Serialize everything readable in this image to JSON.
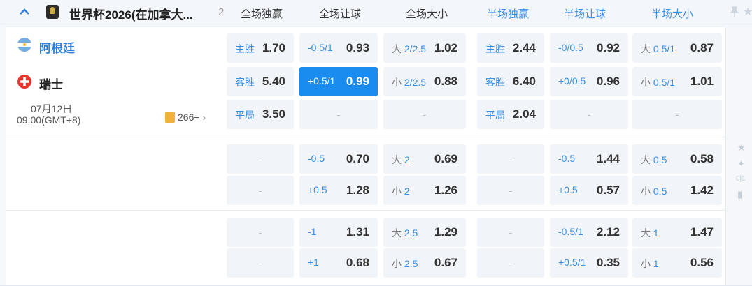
{
  "header": {
    "league": "世界杯2026(在加拿大...",
    "count": "2",
    "columns": [
      "全场独赢",
      "全场让球",
      "全场大小",
      "半场独赢",
      "半场让球",
      "半场大小"
    ]
  },
  "match": {
    "home": "阿根廷",
    "away": "瑞士",
    "date": "07月12日",
    "time": "09:00(GMT+8)",
    "more_bets": "266+"
  },
  "rows": [
    [
      "主胜|1.70",
      "-0.5/1|0.93",
      "大 2/2.5|1.02",
      "主胜|2.44",
      "-0/0.5|0.92",
      "大 0.5/1|0.87"
    ],
    [
      "客胜|5.40",
      "+0.5/1|0.99",
      "小 2/2.5|0.88",
      "客胜|6.40",
      "+0/0.5|0.96",
      "小 0.5/1|1.01"
    ],
    [
      "平局|3.50",
      "-",
      "-",
      "平局|2.04",
      "-",
      "-"
    ],
    [
      "-",
      "-0.5|0.70",
      "大 2|0.69",
      "-",
      "-0.5|1.44",
      "大 0.5|0.58"
    ],
    [
      "-",
      "+0.5|1.28",
      "小 2|1.26",
      "-",
      "+0.5|0.57",
      "小 0.5|1.42"
    ],
    [
      "-",
      "-1|1.31",
      "大 2.5|1.29",
      "-",
      "-0.5/1|2.12",
      "大 1|1.47"
    ],
    [
      "-",
      "+1|0.68",
      "小 2.5|0.67",
      "-",
      "+0.5/1|0.35",
      "小 1|0.56"
    ]
  ],
  "selected": {
    "row": 1,
    "col": 1
  },
  "colors": {
    "accent": "#3a8ee6",
    "selected": "#1a8cf0"
  },
  "rail_labels": {
    "score": "0|1"
  }
}
